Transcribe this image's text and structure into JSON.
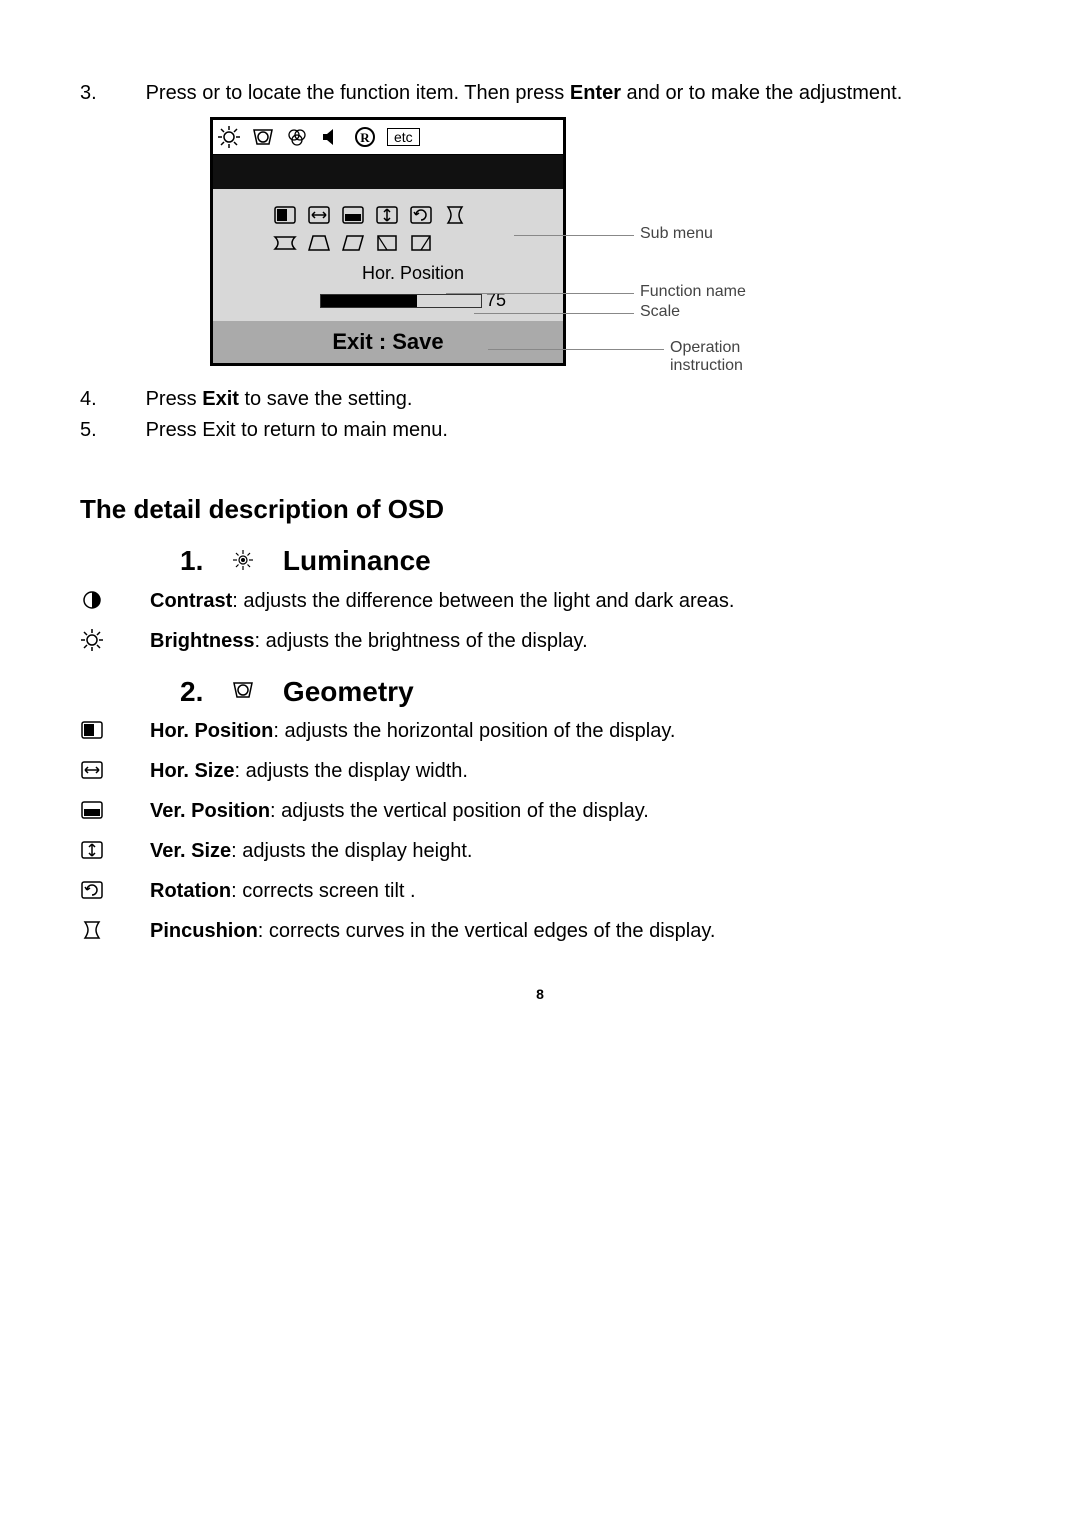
{
  "step3": {
    "num": "3.",
    "text_a": "Press  or     to locate the function item.  Then press ",
    "bold_a": "Enter",
    "text_b": " and    or     to make the adjustment."
  },
  "osd": {
    "etc": "etc",
    "function_name": "Hor. Position",
    "scale_value": "75",
    "exit_save": "Exit : Save"
  },
  "callouts": {
    "submenu": "Sub menu",
    "fnname": "Function name",
    "scale": "Scale",
    "op1": "Operation",
    "op2": "instruction"
  },
  "step4": {
    "num": "4.",
    "text_a": "Press ",
    "bold_a": "Exit",
    "text_b": " to save the setting."
  },
  "step5": {
    "num": "5.",
    "text_a": "Press Exit to return to main menu."
  },
  "detail_header": "The detail description of OSD",
  "sections": {
    "1": {
      "num": "1.",
      "title": "Luminance"
    },
    "2": {
      "num": "2.",
      "title": "Geometry"
    }
  },
  "items": {
    "contrast_b": "Contrast",
    "contrast_t": ": adjusts the difference between the light and dark areas.",
    "brightness_b": "Brightness",
    "brightness_t": ": adjusts the brightness of the display.",
    "hpos_b": "Hor. Position",
    "hpos_t": ": adjusts the horizontal position of the display.",
    "hsize_b": "Hor. Size",
    "hsize_t": ": adjusts the display width.",
    "vpos_b": "Ver. Position",
    "vpos_t": ": adjusts the vertical position of the display.",
    "vsize_b": "Ver. Size",
    "vsize_t": ": adjusts the display height.",
    "rot_b": "Rotation",
    "rot_t": ": corrects screen tilt .",
    "pin_b": "Pincushion",
    "pin_t": ": corrects curves in the vertical edges of the display."
  },
  "page_number": "8"
}
